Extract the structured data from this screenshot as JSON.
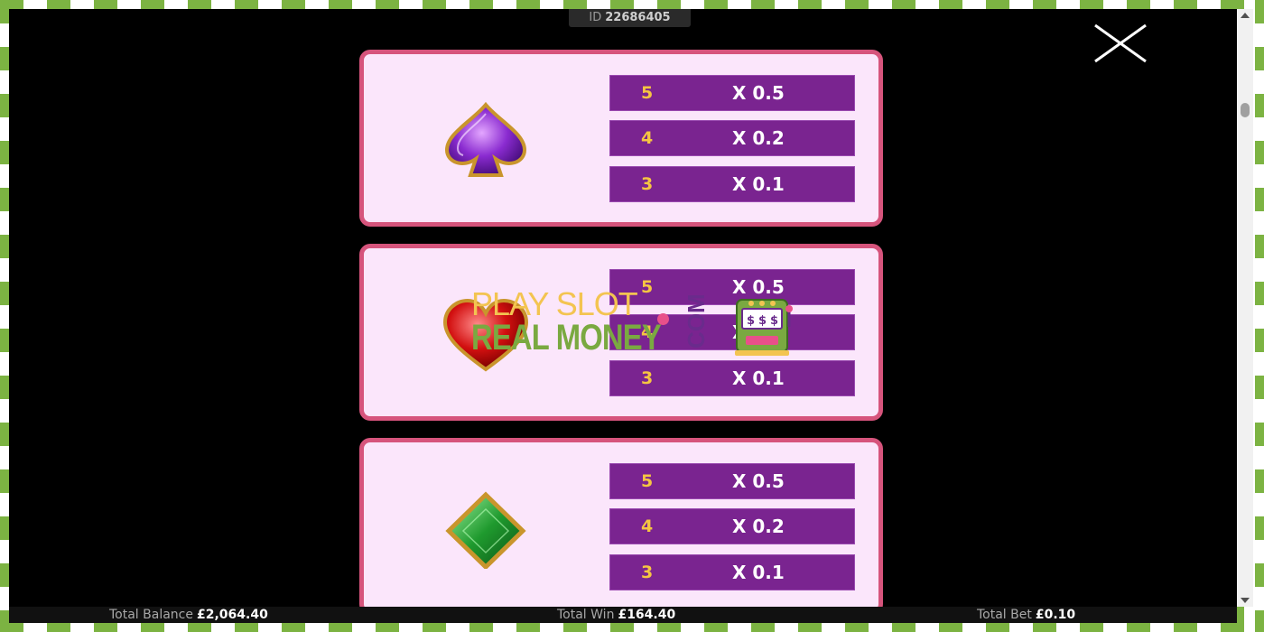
{
  "game": {
    "id_label": "ID",
    "id_value": "22686405"
  },
  "paytable": [
    {
      "symbol": "spade-gem-icon",
      "rows": [
        {
          "count": "5",
          "multiplier": "X 0.5"
        },
        {
          "count": "4",
          "multiplier": "X 0.2"
        },
        {
          "count": "3",
          "multiplier": "X 0.1"
        }
      ]
    },
    {
      "symbol": "heart-gem-icon",
      "rows": [
        {
          "count": "5",
          "multiplier": "X 0.5"
        },
        {
          "count": "4",
          "multiplier": "X 0.2"
        },
        {
          "count": "3",
          "multiplier": "X 0.1"
        }
      ]
    },
    {
      "symbol": "diamond-gem-icon",
      "rows": [
        {
          "count": "5",
          "multiplier": "X 0.5"
        },
        {
          "count": "4",
          "multiplier": "X 0.2"
        },
        {
          "count": "3",
          "multiplier": "X 0.1"
        }
      ]
    }
  ],
  "footer": {
    "balance_label": "Total Balance",
    "balance_value": "£2,064.40",
    "win_label": "Total Win",
    "win_value": "£164.40",
    "bet_label": "Total Bet",
    "bet_value": "£0.10"
  },
  "watermark": {
    "line1": "PLAY SLOT",
    "line2": "REAL MONEY",
    "suffix": "COM"
  },
  "colors": {
    "card_bg": "#fbe6fb",
    "card_border": "#d6547c",
    "row_bg": "#7a2490",
    "count_color": "#f5c542",
    "frame_green": "#7cb342"
  }
}
